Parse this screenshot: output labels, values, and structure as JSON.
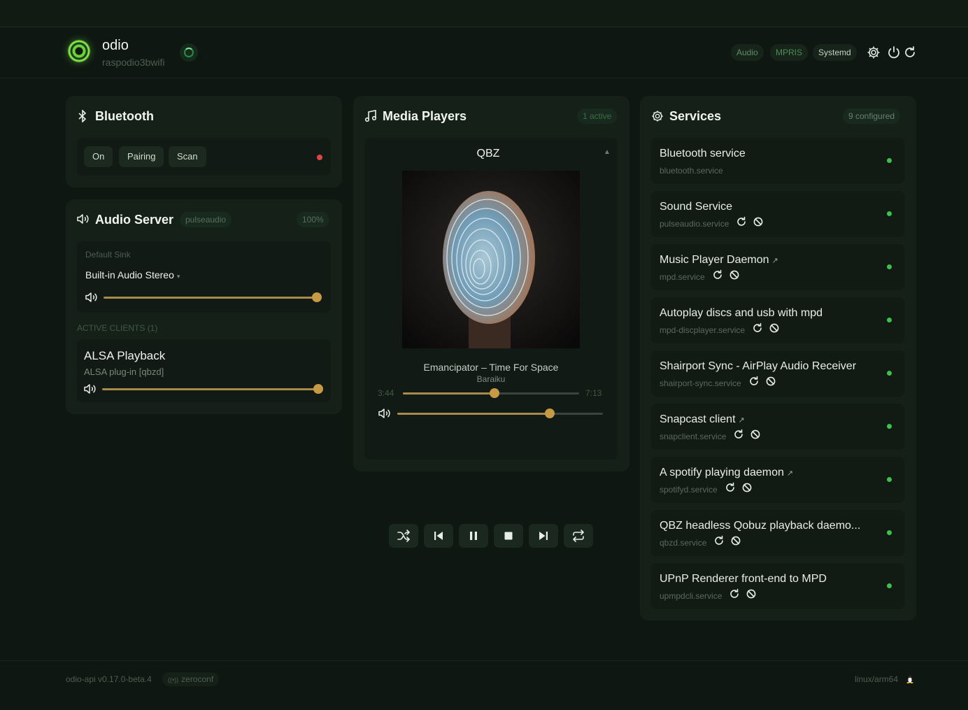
{
  "app": {
    "name": "odio",
    "hostname": "raspodio3bwifi"
  },
  "header": {
    "tabs": [
      "Audio",
      "MPRIS",
      "Systemd"
    ],
    "icons": [
      "gear-icon",
      "power-icon",
      "refresh-icon"
    ]
  },
  "bluetooth": {
    "title": "Bluetooth",
    "buttons": [
      "On",
      "Pairing",
      "Scan"
    ],
    "status_color": "#e04646"
  },
  "audio_server": {
    "title": "Audio Server",
    "backend": "pulseaudio",
    "volume": "100%",
    "default_sink_label": "Default Sink",
    "default_sink": "Built-in Audio Stereo",
    "sink_volume_fraction": 1.0,
    "clients_header": "ACTIVE CLIENTS (1)",
    "clients": [
      {
        "name": "ALSA Playback",
        "detail": "ALSA plug-in [qbzd]",
        "volume_fraction": 1.0
      }
    ]
  },
  "media": {
    "title": "Media Players",
    "badge": "1 active",
    "player": {
      "name": "QBZ",
      "track": "Emancipator – Time For Space",
      "artist": "Baraiku",
      "elapsed": "3:44",
      "duration": "7:13",
      "progress_fraction": 0.52,
      "volume_fraction": 0.74
    }
  },
  "services": {
    "title": "Services",
    "badge": "9 configured",
    "status_color": "#3fc04a",
    "items": [
      {
        "name": "Bluetooth service",
        "unit": "bluetooth.service",
        "external": false,
        "actions": false
      },
      {
        "name": "Sound Service",
        "unit": "pulseaudio.service",
        "external": false,
        "actions": true
      },
      {
        "name": "Music Player Daemon",
        "unit": "mpd.service",
        "external": true,
        "actions": true
      },
      {
        "name": "Autoplay discs and usb with mpd",
        "unit": "mpd-discplayer.service",
        "external": false,
        "actions": true
      },
      {
        "name": "Shairport Sync - AirPlay Audio Receiver",
        "unit": "shairport-sync.service",
        "external": false,
        "actions": true
      },
      {
        "name": "Snapcast client",
        "unit": "snapclient.service",
        "external": true,
        "actions": true
      },
      {
        "name": "A spotify playing daemon",
        "unit": "spotifyd.service",
        "external": true,
        "actions": true
      },
      {
        "name": "QBZ headless Qobuz playback daemo...",
        "unit": "qbzd.service",
        "external": false,
        "actions": true
      },
      {
        "name": "UPnP Renderer front-end to MPD",
        "unit": "upmpdcli.service",
        "external": false,
        "actions": true
      }
    ]
  },
  "footer": {
    "version": "odio-api v0.17.0-beta.4",
    "zeroconf": "zeroconf",
    "platform": "linux/arm64"
  }
}
